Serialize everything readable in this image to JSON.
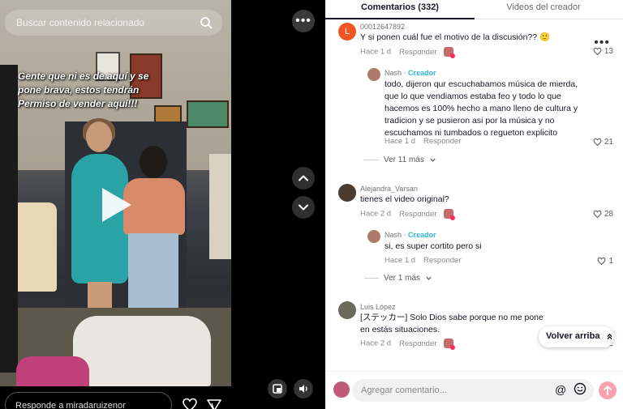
{
  "video": {
    "search_placeholder": "Buscar contenido relacionado",
    "overlay_text": "Gente que ni es de aquí y se pone brava, estos tendrán Permiso de vender aquí!!!",
    "reply_placeholder": "Responde a miradaruizenor"
  },
  "tabs": {
    "comments": "Comentarios (332)",
    "creator_videos": "Videos del creador"
  },
  "comments": [
    {
      "username": "00012647892",
      "avatar_letter": "L",
      "avatar_color": "#f25522",
      "text": "Y si ponen cuál fue el motivo de la discusión?? 🙂",
      "time": "Hace 1 d",
      "reply_label": "Responder",
      "likes": "13"
    },
    {
      "username": "Nash",
      "creator_badge": "Creador",
      "text": "todo, dijeron qur escuchabamos música de mierda, que lo que vendiamos estaba feo y todo lo que hacemos es 100% hecho a mano lleno de cultura y tradicion y se pusieron asi por la música y no escuchamos ni tumbados o regueton explicito",
      "time": "Hace 1 d",
      "reply_label": "Responder",
      "likes": "21"
    },
    {
      "username": "Alejandra_Varsan",
      "text": "tienes el video original?",
      "time": "Hace 2 d",
      "reply_label": "Responder",
      "likes": "28"
    },
    {
      "username": "Nash",
      "creator_badge": "Creador",
      "text": "si, es super cortito pero si",
      "time": "Hace 1 d",
      "reply_label": "Responder",
      "likes": "1"
    },
    {
      "username": "Luis López",
      "text": "[ステッカー] Solo Dios sabe porque no me pone en estás situaciones.",
      "time": "Hace 2 d",
      "reply_label": "Responder",
      "likes": "2"
    }
  ],
  "see_more": [
    "Ver 11 más",
    "Ver 1 más"
  ],
  "back_to_top": "Volver arriba",
  "composer_placeholder": "Agregar comentario...",
  "colors": {
    "creator": "#2fb4d8",
    "send_button": "#f8a1b1",
    "accent": "#fe2c55"
  }
}
